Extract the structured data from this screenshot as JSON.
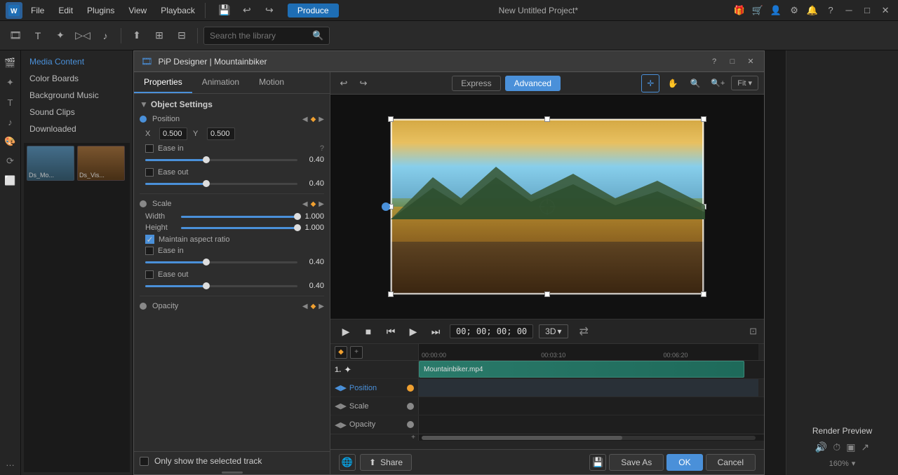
{
  "app": {
    "title": "New Untitled Project*",
    "produce_label": "Produce"
  },
  "menu": {
    "items": [
      "File",
      "Edit",
      "Plugins",
      "View",
      "Playback"
    ]
  },
  "toolbar2": {
    "search_placeholder": "Search the library"
  },
  "media_panel": {
    "title": "Media Content",
    "items": [
      {
        "label": "Media Content",
        "active": true
      },
      {
        "label": "Color Boards"
      },
      {
        "label": "Background Music"
      },
      {
        "label": "Sound Clips"
      },
      {
        "label": "Downloaded"
      }
    ]
  },
  "pip_dialog": {
    "title": "PiP Designer | Mountainbiker",
    "tabs": [
      "Properties",
      "Animation",
      "Motion"
    ],
    "active_tab": "Properties",
    "express_label": "Express",
    "advanced_label": "Advanced",
    "fit_label": "Fit"
  },
  "object_settings": {
    "section_label": "Object Settings",
    "position": {
      "label": "Position",
      "x_label": "X",
      "x_val": "0.500",
      "y_label": "Y",
      "y_val": "0.500",
      "ease_in_label": "Ease in",
      "ease_in_val": "0.40",
      "ease_out_label": "Ease out",
      "ease_out_val": "0.40"
    },
    "scale": {
      "label": "Scale",
      "width_label": "Width",
      "width_val": "1.000",
      "height_label": "Height",
      "height_val": "1.000",
      "maintain_aspect": "Maintain aspect ratio",
      "ease_in_label": "Ease in",
      "ease_in_val": "0.40",
      "ease_out_label": "Ease out",
      "ease_out_val": "0.40"
    },
    "opacity": {
      "label": "Opacity"
    }
  },
  "playback": {
    "timecode": "00; 00; 00; 00",
    "view_3d": "3D",
    "timeline_marks": [
      "00:00:00",
      "00:03:10",
      "00:06:20"
    ]
  },
  "timeline": {
    "tracks": [
      {
        "label": "Position",
        "active": true
      },
      {
        "label": "Scale"
      },
      {
        "label": "Opacity"
      }
    ],
    "clip_name": "Mountainbiker.mp4"
  },
  "bottom_bar": {
    "share_label": "Share",
    "save_as_label": "Save As",
    "ok_label": "OK",
    "cancel_label": "Cancel"
  },
  "render_preview": {
    "label": "Render Preview"
  },
  "only_track": {
    "label": "Only show the selected track"
  }
}
